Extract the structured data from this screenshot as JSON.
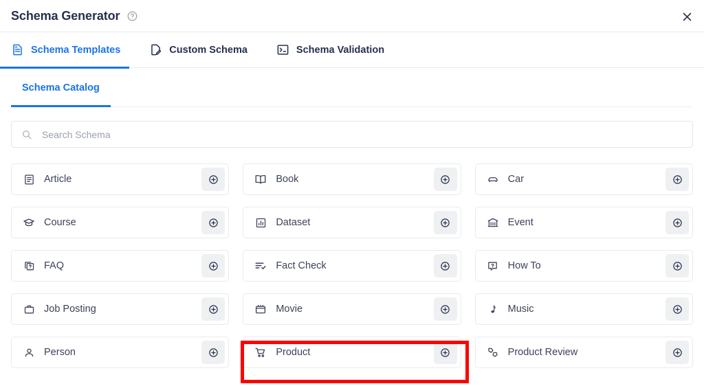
{
  "window": {
    "title": "Schema Generator",
    "help_icon": "help-circle-icon",
    "close_icon": "close-icon"
  },
  "tabs": [
    {
      "label": "Schema Templates",
      "icon": "document-lines-icon",
      "active": true
    },
    {
      "label": "Custom Schema",
      "icon": "document-pencil-icon",
      "active": false
    },
    {
      "label": "Schema Validation",
      "icon": "terminal-icon",
      "active": false
    }
  ],
  "subtabs": [
    {
      "label": "Schema Catalog",
      "active": true
    }
  ],
  "search": {
    "placeholder": "Search Schema",
    "value": "",
    "icon": "search-icon"
  },
  "catalog": {
    "add_button_icon": "plus-circle-icon",
    "items": [
      {
        "label": "Article",
        "icon": "article-icon",
        "highlighted": false
      },
      {
        "label": "Book",
        "icon": "book-icon",
        "highlighted": false
      },
      {
        "label": "Car",
        "icon": "car-icon",
        "highlighted": false
      },
      {
        "label": "Course",
        "icon": "graduation-cap-icon",
        "highlighted": false
      },
      {
        "label": "Dataset",
        "icon": "chart-box-icon",
        "highlighted": false
      },
      {
        "label": "Event",
        "icon": "ticket-booth-icon",
        "highlighted": false
      },
      {
        "label": "FAQ",
        "icon": "faq-icon",
        "highlighted": false
      },
      {
        "label": "Fact Check",
        "icon": "list-check-icon",
        "highlighted": false
      },
      {
        "label": "How To",
        "icon": "question-box-icon",
        "highlighted": false
      },
      {
        "label": "Job Posting",
        "icon": "briefcase-icon",
        "highlighted": false
      },
      {
        "label": "Movie",
        "icon": "clapperboard-icon",
        "highlighted": false
      },
      {
        "label": "Music",
        "icon": "music-note-icon",
        "highlighted": false
      },
      {
        "label": "Person",
        "icon": "person-icon",
        "highlighted": false
      },
      {
        "label": "Product",
        "icon": "shopping-cart-icon",
        "highlighted": true
      },
      {
        "label": "Product Review",
        "icon": "review-tags-icon",
        "highlighted": false
      }
    ]
  },
  "colors": {
    "accent": "#1a73e8",
    "text": "#26304e",
    "card_text": "#3c4257",
    "annotation": "#ff0000",
    "border": "#e8eaec"
  }
}
